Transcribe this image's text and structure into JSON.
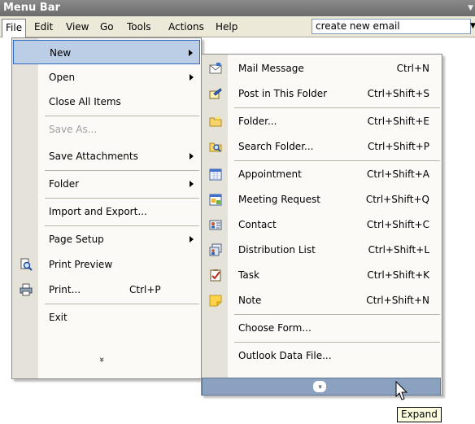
{
  "window": {
    "title": "Menu Bar"
  },
  "menubar": {
    "items": [
      "File",
      "Edit",
      "View",
      "Go",
      "Tools",
      "Actions",
      "Help"
    ],
    "ask_box": "create new email"
  },
  "file_menu": {
    "items": [
      {
        "label": "New",
        "submenu": true,
        "highlighted": true
      },
      {
        "label": "Open",
        "submenu": true
      },
      {
        "label": "Close All Items"
      },
      {
        "label": "Save As...",
        "disabled": true
      },
      {
        "label": "Save Attachments",
        "submenu": true
      },
      {
        "label": "Folder",
        "submenu": true
      },
      {
        "label": "Import and Export..."
      },
      {
        "label": "Page Setup",
        "submenu": true
      },
      {
        "label": "Print Preview",
        "icon": "print-preview-icon"
      },
      {
        "label": "Print...",
        "shortcut": "Ctrl+P",
        "icon": "printer-icon"
      },
      {
        "label": "Exit"
      }
    ],
    "chevron": "»"
  },
  "new_submenu": {
    "items": [
      {
        "label": "Mail Message",
        "shortcut": "Ctrl+N",
        "icon": "mail-message-icon"
      },
      {
        "label": "Post in This Folder",
        "shortcut": "Ctrl+Shift+S",
        "icon": "post-icon"
      },
      {
        "label": "Folder...",
        "shortcut": "Ctrl+Shift+E",
        "icon": "folder-icon"
      },
      {
        "label": "Search Folder...",
        "shortcut": "Ctrl+Shift+P",
        "icon": "search-folder-icon"
      },
      {
        "label": "Appointment",
        "shortcut": "Ctrl+Shift+A",
        "icon": "appointment-icon"
      },
      {
        "label": "Meeting Request",
        "shortcut": "Ctrl+Shift+Q",
        "icon": "meeting-request-icon"
      },
      {
        "label": "Contact",
        "shortcut": "Ctrl+Shift+C",
        "icon": "contact-icon"
      },
      {
        "label": "Distribution List",
        "shortcut": "Ctrl+Shift+L",
        "icon": "distribution-list-icon"
      },
      {
        "label": "Task",
        "shortcut": "Ctrl+Shift+K",
        "icon": "task-icon"
      },
      {
        "label": "Note",
        "shortcut": "Ctrl+Shift+N",
        "icon": "note-icon"
      },
      {
        "label": "Choose Form..."
      },
      {
        "label": "Outlook Data File..."
      }
    ],
    "chevron": "»"
  },
  "tooltip": "Expand",
  "colors": {
    "highlight": "#bccde6",
    "highlight_border": "#316ac5",
    "expand_bar": "#8aa1bf"
  }
}
